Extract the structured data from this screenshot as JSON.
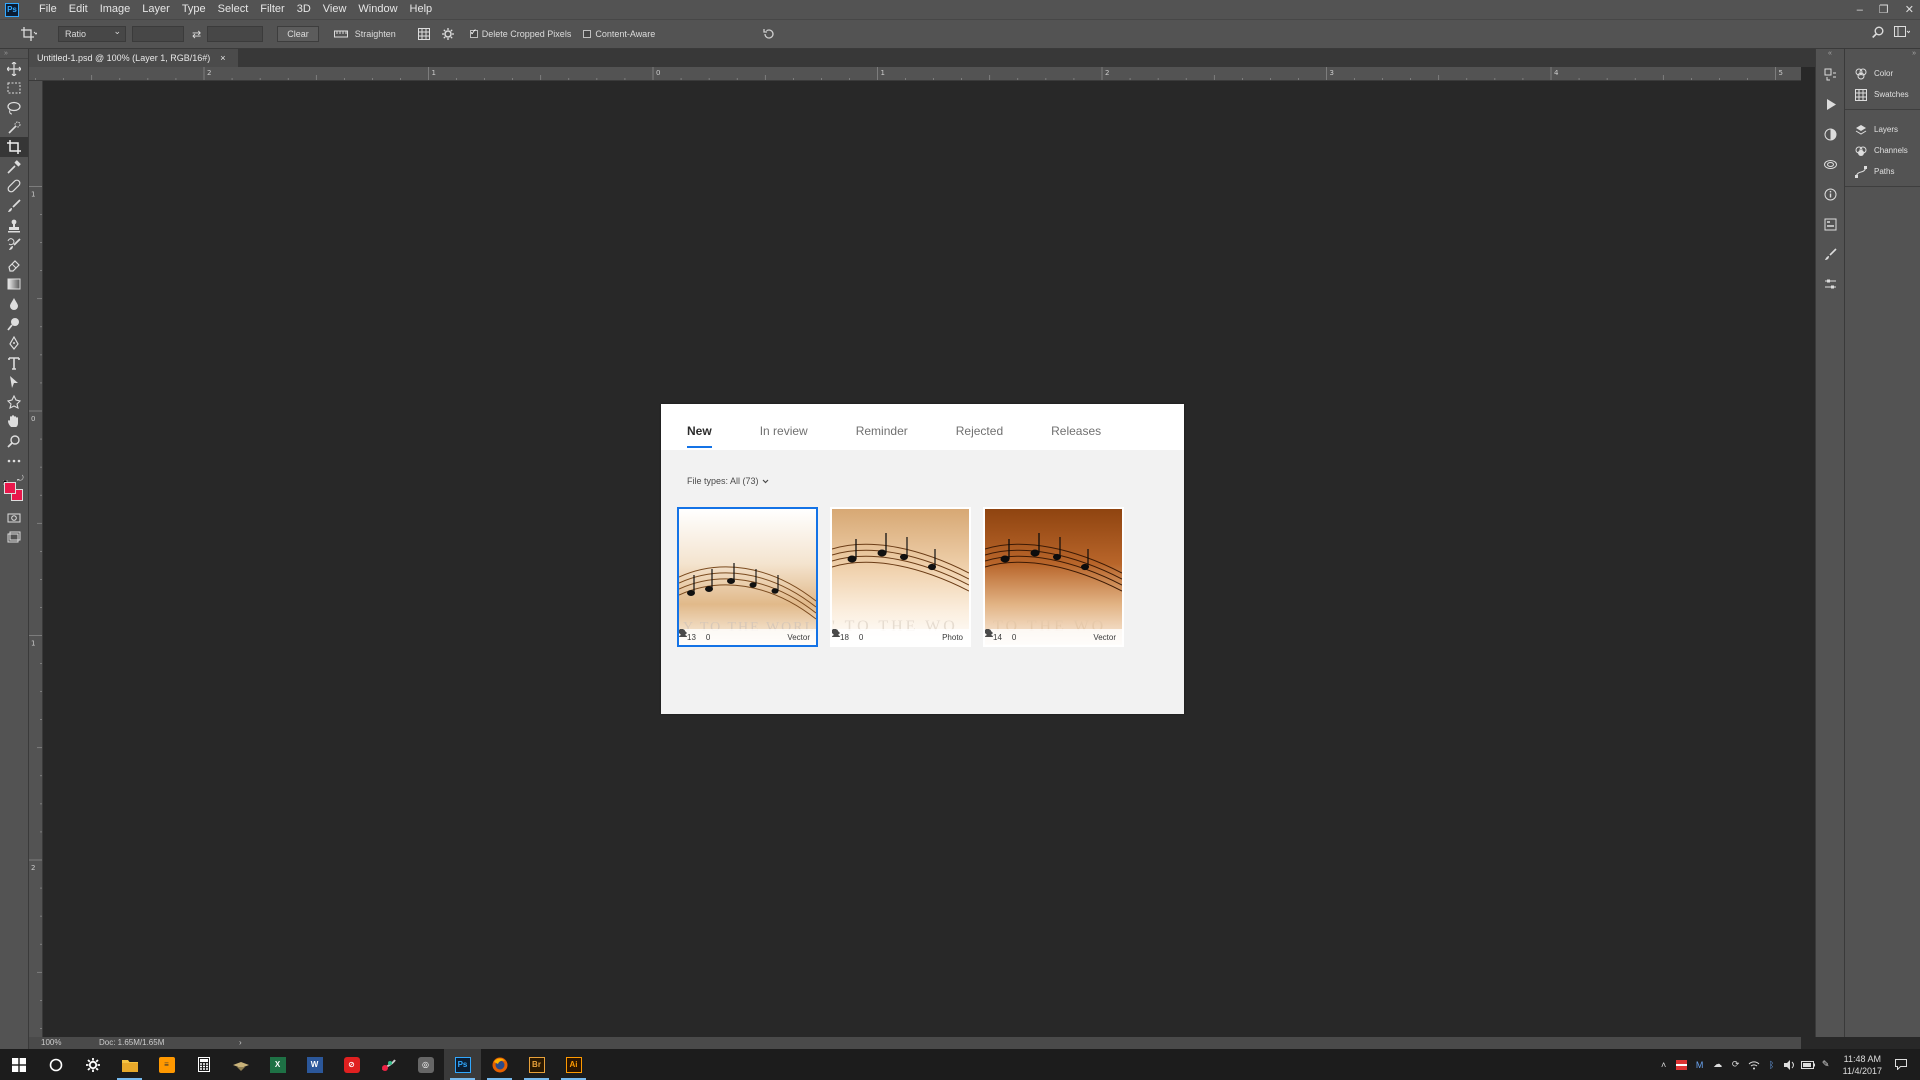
{
  "app": {
    "logo_text": "Ps",
    "menu": [
      "File",
      "Edit",
      "Image",
      "Layer",
      "Type",
      "Select",
      "Filter",
      "3D",
      "View",
      "Window",
      "Help"
    ],
    "window_controls": [
      "–",
      "❐",
      "✕"
    ]
  },
  "options_bar": {
    "ratio_value": "Ratio",
    "clear_label": "Clear",
    "straighten_label": "Straighten",
    "delete_cropped_label": "Delete Cropped Pixels",
    "delete_cropped_checked": true,
    "content_aware_label": "Content-Aware",
    "content_aware_checked": false
  },
  "document": {
    "tab_title": "Untitled-1.psd @ 100% (Layer 1, RGB/16#)",
    "close": "×"
  },
  "colors": {
    "foreground": "#e8174b",
    "background": "#e8174b",
    "accent": "#1473e6"
  },
  "ruler": {
    "top_labels": [
      "2",
      "1",
      "0",
      "1",
      "2",
      "3",
      "4",
      "5"
    ],
    "left_labels": [
      "1",
      "0",
      "1",
      "2"
    ]
  },
  "status": {
    "zoom": "100%",
    "doc": "Doc: 1.65M/1.65M"
  },
  "right_panels": {
    "group1": [
      "Color",
      "Swatches"
    ],
    "group2": [
      "Layers",
      "Channels",
      "Paths"
    ]
  },
  "dialog": {
    "tabs": [
      "New",
      "In review",
      "Reminder",
      "Rejected",
      "Releases"
    ],
    "active_tab": "New",
    "file_types_label": "File types: All (73)",
    "thumbnails": [
      {
        "keywords": "13",
        "people": "0",
        "type": "Vector",
        "selected": true,
        "theme": "light"
      },
      {
        "keywords": "18",
        "people": "0",
        "type": "Photo",
        "selected": false,
        "theme": "beige"
      },
      {
        "keywords": "14",
        "people": "0",
        "type": "Vector",
        "selected": false,
        "theme": "dark"
      }
    ]
  },
  "taskbar": {
    "time": "11:48 AM",
    "date": "11/4/2017"
  }
}
